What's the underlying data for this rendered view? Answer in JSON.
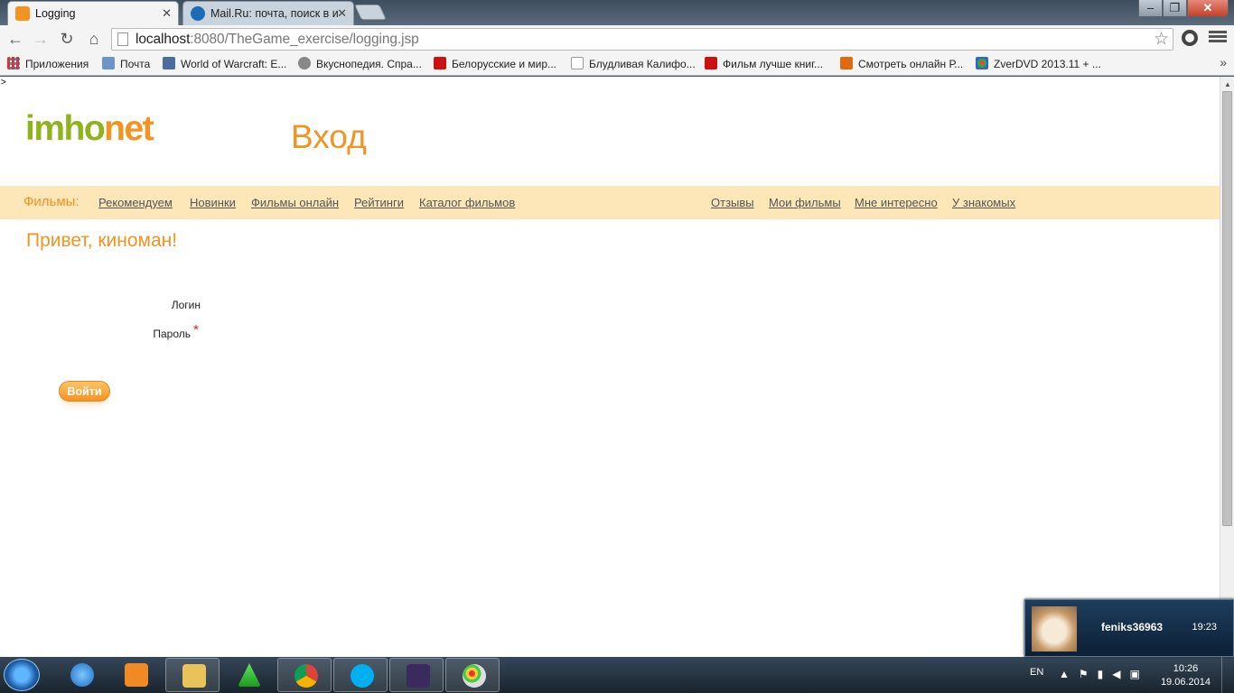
{
  "browser": {
    "tabs": [
      {
        "label": "Logging",
        "state": "active"
      },
      {
        "label": "Mail.Ru: почта, поиск в и",
        "state": "inactive"
      }
    ],
    "address": {
      "host": "localhost",
      "rest": ":8080/TheGame_exercise/logging.jsp"
    },
    "bookmarks": [
      {
        "label": "Приложения",
        "icon": "apps-grid-icon"
      },
      {
        "label": "Почта",
        "icon": "mail-icon"
      },
      {
        "label": "World of Warcraft: E...",
        "icon": "vk-icon"
      },
      {
        "label": "Вкуснопедия. Спра...",
        "icon": "feather-icon"
      },
      {
        "label": "Белорусские и мир...",
        "icon": "shield-icon"
      },
      {
        "label": "Блудливая Калифо...",
        "icon": "page-icon"
      },
      {
        "label": "Фильм лучше книг...",
        "icon": "shield-icon"
      },
      {
        "label": "Смотреть онлайн Р...",
        "icon": "f-icon"
      },
      {
        "label": "ZverDVD 2013.11 + ...",
        "icon": "flower-icon"
      }
    ],
    "bookmarks_more": "»"
  },
  "page": {
    "stray_char": ">",
    "logo": {
      "part1": "imho",
      "part2": "net"
    },
    "title": "Вход",
    "nav_label": "Фильмы:",
    "nav_left": [
      "Рекомендуем",
      "Новинки",
      "Фильмы онлайн",
      "Рейтинги",
      "Каталог фильмов"
    ],
    "nav_right": [
      "Отзывы",
      "Мои фильмы",
      "Мне интересно",
      "У знакомых"
    ],
    "greeting": "Привет, киноман!",
    "login_label": "Логин",
    "password_label": "Пароль",
    "required_mark": "*",
    "submit_label": "Войти"
  },
  "notification": {
    "user": "feniks36963",
    "time": "19:23"
  },
  "taskbar": {
    "lang": "EN",
    "clock_time": "10:26",
    "clock_date": "19.06.2014"
  },
  "colors": {
    "brand_orange": "#f39321",
    "brand_green": "#8fb31d",
    "nav_bg": "#fde7b9"
  }
}
